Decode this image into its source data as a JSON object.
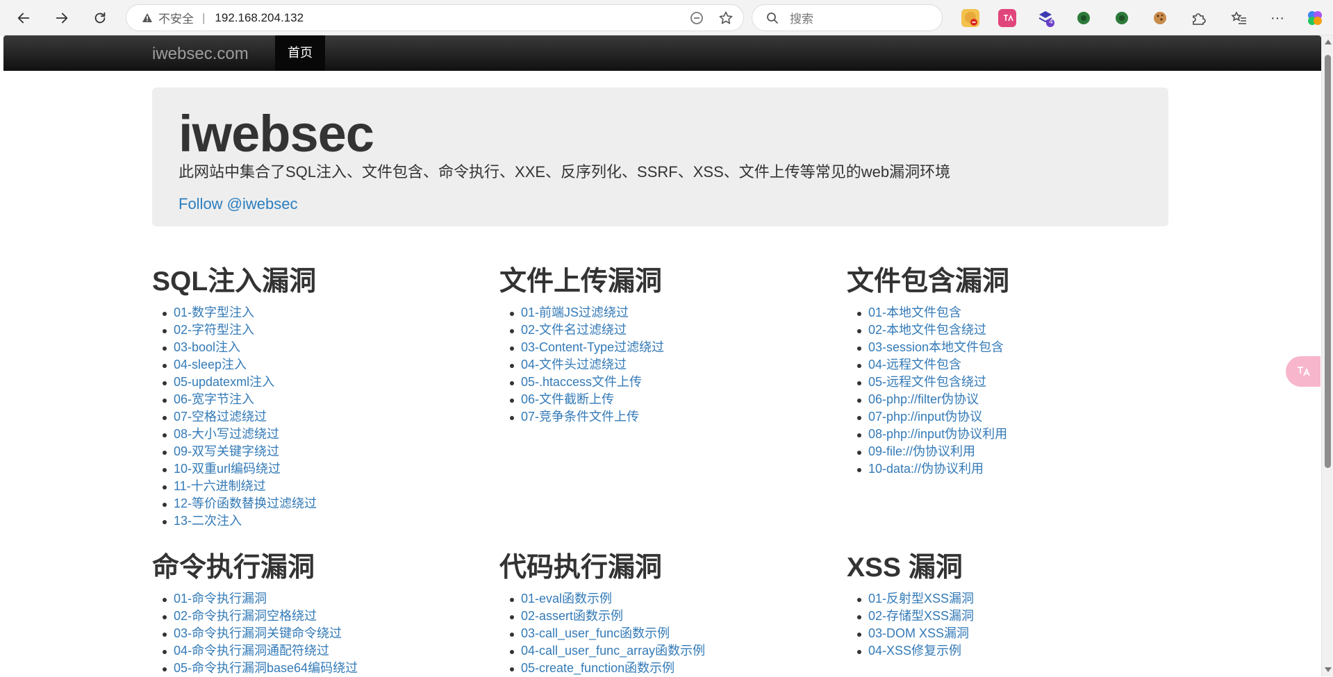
{
  "browser": {
    "insecure_label": "不安全",
    "separator": "|",
    "url": "192.168.204.132",
    "search_placeholder": "搜索",
    "extension_badge": "4",
    "more_label": "···"
  },
  "navbar": {
    "brand": "iwebsec.com",
    "home": "首页"
  },
  "jumbotron": {
    "title": "iwebsec",
    "description": "此网站中集合了SQL注入、文件包含、命令执行、XXE、反序列化、SSRF、XSS、文件上传等常见的web漏洞环境",
    "follow": "Follow @iwebsec"
  },
  "sections": [
    {
      "title": "SQL注入漏洞",
      "items": [
        "01-数字型注入",
        "02-字符型注入",
        "03-bool注入",
        "04-sleep注入",
        "05-updatexml注入",
        "06-宽字节注入",
        "07-空格过滤绕过",
        "08-大小写过滤绕过",
        "09-双写关键字绕过",
        "10-双重url编码绕过",
        "11-十六进制绕过",
        "12-等价函数替换过滤绕过",
        "13-二次注入"
      ]
    },
    {
      "title": "文件上传漏洞",
      "items": [
        "01-前端JS过滤绕过",
        "02-文件名过滤绕过",
        "03-Content-Type过滤绕过",
        "04-文件头过滤绕过",
        "05-.htaccess文件上传",
        "06-文件截断上传",
        "07-竞争条件文件上传"
      ]
    },
    {
      "title": "文件包含漏洞",
      "items": [
        "01-本地文件包含",
        "02-本地文件包含绕过",
        "03-session本地文件包含",
        "04-远程文件包含",
        "05-远程文件包含绕过",
        "06-php://filter伪协议",
        "07-php://input伪协议",
        "08-php://input伪协议利用",
        "09-file://伪协议利用",
        "10-data://伪协议利用"
      ]
    },
    {
      "title": "命令执行漏洞",
      "items": [
        "01-命令执行漏洞",
        "02-命令执行漏洞空格绕过",
        "03-命令执行漏洞关键命令绕过",
        "04-命令执行漏洞通配符绕过",
        "05-命令执行漏洞base64编码绕过"
      ]
    },
    {
      "title": "代码执行漏洞",
      "items": [
        "01-eval函数示例",
        "02-assert函数示例",
        "03-call_user_func函数示例",
        "04-call_user_func_array函数示例",
        "05-create_function函数示例"
      ]
    },
    {
      "title": "XSS 漏洞",
      "items": [
        "01-反射型XSS漏洞",
        "02-存储型XSS漏洞",
        "03-DOM XSS漏洞",
        "04-XSS修复示例"
      ]
    }
  ]
}
